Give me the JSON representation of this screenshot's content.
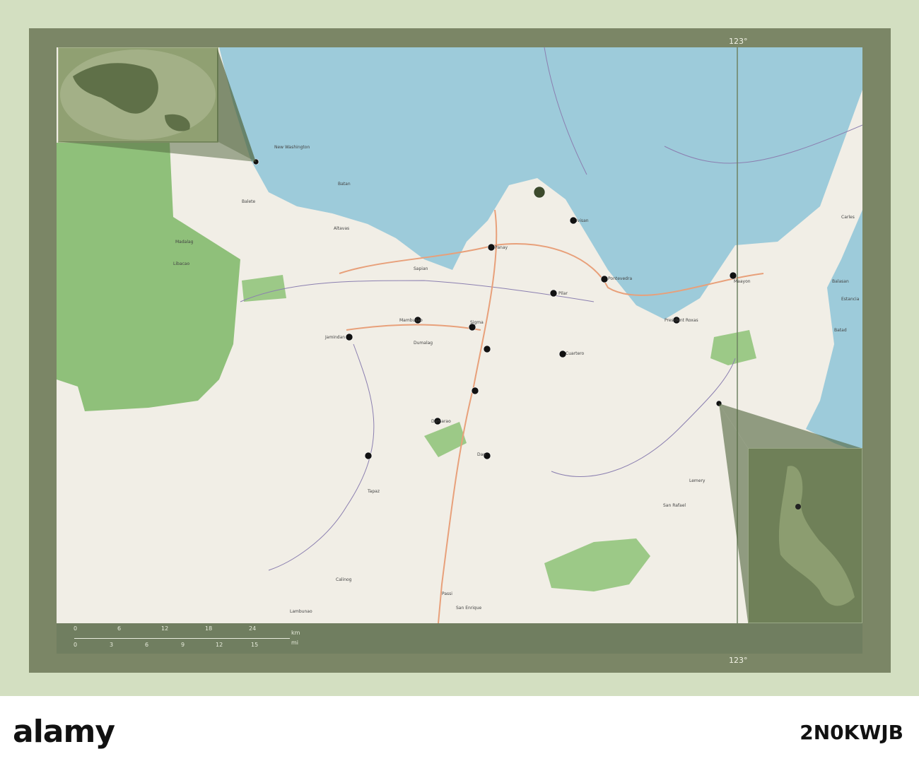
{
  "map": {
    "grid_labels": {
      "top_lon": "123°",
      "bottom_lon": "123°"
    },
    "places": [
      "New Washington",
      "Batan",
      "Balete",
      "Altavas",
      "Madalag",
      "Libacao",
      "Sapian",
      "Jamindan",
      "Mambusao",
      "Dumarao",
      "Dao",
      "Cuartero",
      "Sigma",
      "Panay",
      "Pontevedra",
      "Ivisan",
      "Maayon",
      "President Roxas",
      "Pilar",
      "Tapaz",
      "Dumalag",
      "Calinog",
      "Lambunao",
      "Passi",
      "San Enrique",
      "San Rafael",
      "Lemery",
      "Balasan",
      "Estancia",
      "Carles",
      "Batad"
    ],
    "marker_count": 18
  },
  "scale": {
    "km_label": "km",
    "mi_label": "mi",
    "km": [
      "0",
      "6",
      "12",
      "18",
      "24"
    ],
    "mi": [
      "0",
      "3",
      "6",
      "9",
      "12",
      "15"
    ]
  },
  "footer": {
    "logo": "alamy",
    "image_id": "2N0KWJB"
  }
}
